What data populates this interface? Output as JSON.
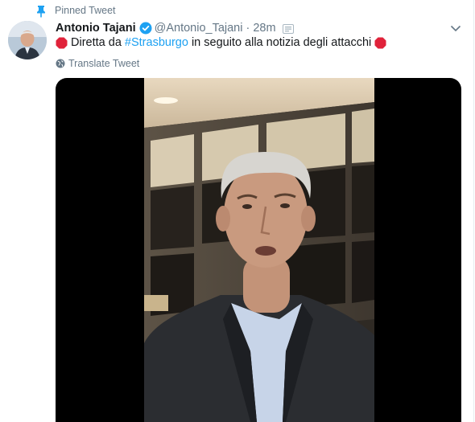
{
  "pinned": {
    "label": "Pinned Tweet",
    "icon": "pin-icon"
  },
  "author": {
    "name": "Antonio Tajani",
    "handle": "@Antonio_Tajani",
    "time": "28m",
    "verified": true
  },
  "tweet": {
    "text_before": " Diretta da ",
    "hashtag": "#Strasburgo",
    "text_after": " in seguito alla notizia degli attacchi ",
    "stop_sign_icon": "stop-sign-icon"
  },
  "translate_label": "Translate Tweet",
  "colors": {
    "link": "#1da1f2",
    "secondary": "#657786",
    "primary": "#14171a",
    "stop_sign": "#e0223a",
    "verified": "#1da1f2"
  }
}
